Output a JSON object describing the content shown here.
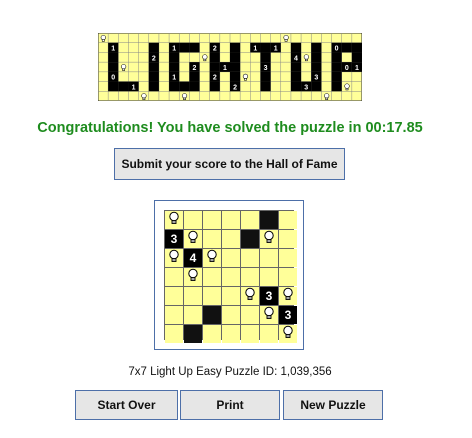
{
  "logo": {
    "text": "LIGHT UP",
    "clue_digits": [
      "1",
      "2",
      "1",
      "2",
      "2",
      "1",
      "2",
      "1",
      "3",
      "4",
      "3",
      "0",
      "1",
      "0",
      "1",
      "1",
      "3",
      "0",
      "2",
      "1"
    ]
  },
  "status": {
    "message": "Congratulations! You have solved the puzzle in 00:17.85"
  },
  "buttons": {
    "submit_label": "Submit your score to the Hall of Fame",
    "start_over_label": "Start Over",
    "print_label": "Print",
    "new_puzzle_label": "New Puzzle"
  },
  "puzzle": {
    "info": "7x7 Light Up Easy Puzzle ID: 1,039,356",
    "size": 7,
    "grid": [
      [
        "B",
        ".",
        ".",
        ".",
        ".",
        "X",
        "."
      ],
      [
        "3",
        "B",
        ".",
        ".",
        "X",
        "B",
        "."
      ],
      [
        "B",
        "4",
        "B",
        ".",
        ".",
        ".",
        "."
      ],
      [
        ".",
        "B",
        ".",
        ".",
        ".",
        ".",
        "."
      ],
      [
        ".",
        ".",
        ".",
        ".",
        "B",
        "3",
        "B"
      ],
      [
        ".",
        ".",
        "X",
        ".",
        ".",
        "B",
        "3"
      ],
      [
        ".",
        "X",
        ".",
        ".",
        ".",
        ".",
        "B"
      ]
    ]
  },
  "colors": {
    "lit": "#ffff99",
    "congrats": "#1e8c1e",
    "button_border": "#4d6fa8"
  }
}
